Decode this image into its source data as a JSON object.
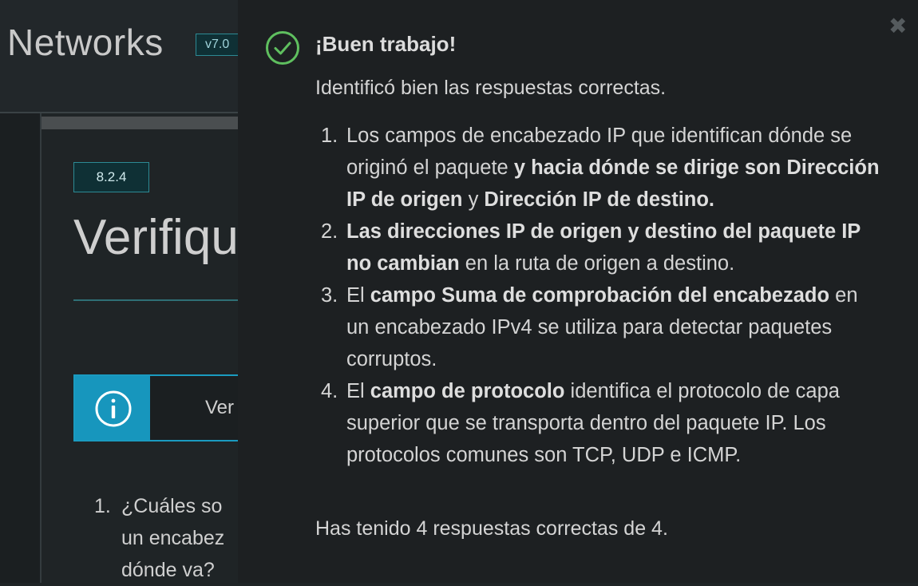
{
  "course": {
    "title": "Networks",
    "version": "v7.0"
  },
  "section": {
    "badge": "8.2.4",
    "heading_partial": "Verifiqu"
  },
  "info_box": {
    "text_partial": "Ver"
  },
  "background_question": {
    "number": "1.",
    "lines": [
      "¿Cuáles so",
      "un encabez",
      "dónde va?"
    ]
  },
  "feedback": {
    "close_symbol": "✖",
    "heading": "¡Buen trabajo!",
    "intro": "Identificó bien las respuestas correctas.",
    "items": [
      {
        "number": "1.",
        "t1": "Los campos de encabezado IP que identifican dónde se originó el paquete ",
        "b1": "y hacia dónde se dirige son Dirección IP de origen",
        "t2": " y ",
        "b2": "Dirección IP de destino."
      },
      {
        "number": "2.",
        "b1": "Las direcciones IP de origen y destino del paquete IP no cambian",
        "t1": " en la ruta de origen a destino."
      },
      {
        "number": "3.",
        "t1": "El ",
        "b1": "campo Suma de comprobación del encabezado",
        "t2": " en un encabezado IPv4 se utiliza para detectar paquetes corruptos."
      },
      {
        "number": "4.",
        "t1": "El ",
        "b1": "campo de protocolo",
        "t2": " identifica el protocolo de capa superior que se transporta dentro del paquete IP. Los protocolos comunes son TCP, UDP e ICMP."
      }
    ],
    "summary": "Has tenido 4 respuestas correctas de 4."
  },
  "colors": {
    "accent_teal": "#2d8a94",
    "info_blue": "#1796bd",
    "success_green": "#5fbf5f",
    "panel_bg": "#1d2022"
  },
  "icons": [
    "check-circle-icon",
    "close-icon",
    "info-icon"
  ]
}
